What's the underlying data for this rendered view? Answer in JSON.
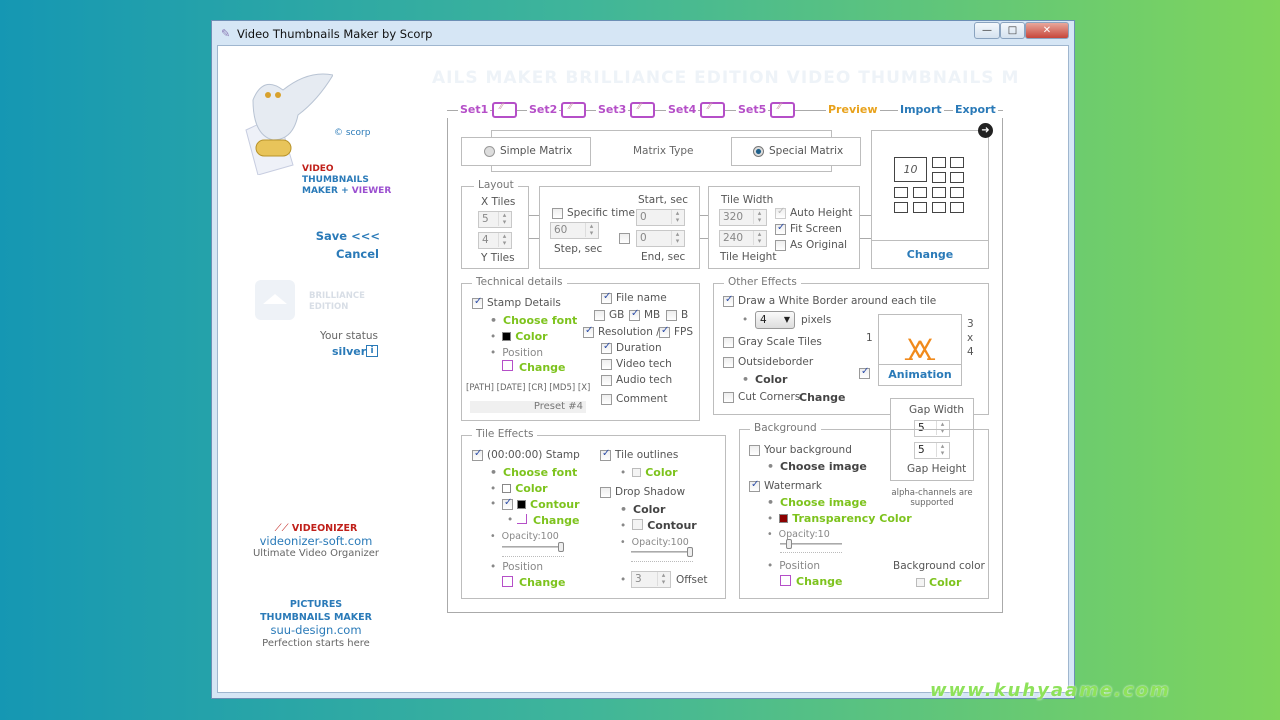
{
  "window": {
    "title": "Video Thumbnails Maker by Scorp",
    "min": "—",
    "max": "□",
    "close": "✕"
  },
  "watermark_text": "AILS MAKER BRILLIANCE EDITION VIDEO THUMBNAILS M",
  "site_watermark": "www.kuhyaame.com",
  "sidebar": {
    "copyright": "© scorp",
    "logo_line1": "VIDEO",
    "logo_line2": "THUMBNAILS",
    "logo_line3a": "MAKER + ",
    "logo_line3b": "VIEWER",
    "save": "Save <<<",
    "cancel": "Cancel",
    "edition": "BRILLIANCE\nEDITION",
    "status_label": "Your status",
    "status_value": "silver",
    "info": "i",
    "promo1": {
      "name": "VIDEONIZER",
      "url": "videonizer-soft.com",
      "tagline": "Ultimate Video Organizer"
    },
    "promo2": {
      "name1": "PICTURES",
      "name2": "THUMBNAILS MAKER",
      "url": "suu-design.com",
      "tagline": "Perfection starts here"
    }
  },
  "nav": {
    "sets": [
      "Set1",
      "Set2",
      "Set3",
      "Set4",
      "Set5"
    ],
    "preview": "Preview",
    "import": "Import",
    "export": "Export"
  },
  "matrix": {
    "simple": "Simple Matrix",
    "type_label": "Matrix Type",
    "special": "Special Matrix",
    "selected": "special",
    "preview_number": "10",
    "change": "Change"
  },
  "layout": {
    "legend": "Layout",
    "x_label": "X Tiles",
    "x_value": "5",
    "y_value": "4",
    "y_label": "Y Tiles"
  },
  "timing": {
    "specific_time": "Specific time",
    "specific_checked": false,
    "start_label": "Start, sec",
    "start_value": "0",
    "step_value": "60",
    "step_label": "Step, sec",
    "end_checked": false,
    "end_value": "0",
    "end_label": "End, sec"
  },
  "tile_size": {
    "width_label": "Tile Width",
    "width": "320",
    "height": "240",
    "height_label": "Tile Height",
    "auto_height": "Auto Height",
    "auto_height_checked": true,
    "fit_screen": "Fit Screen",
    "fit_screen_checked": true,
    "as_original": "As Original",
    "as_original_checked": false
  },
  "technical": {
    "legend": "Technical  details",
    "stamp_details": "Stamp Details",
    "stamp_checked": true,
    "choose_font": "Choose font",
    "color": "Color",
    "position": "Position",
    "change": "Change",
    "tokens": "[PATH] [DATE] [CR] [MD5]  [X]",
    "preset": "Preset #4",
    "file_name": "File name",
    "file_name_checked": true,
    "gb": "GB",
    "gb_checked": false,
    "mb": "MB",
    "mb_checked": true,
    "b": "B",
    "b_checked": false,
    "resolution": "Resolution /",
    "resolution_checked": true,
    "fps": "FPS",
    "fps_checked": true,
    "duration": "Duration",
    "duration_checked": true,
    "video_tech": "Video tech",
    "video_tech_checked": false,
    "audio_tech": "Audio tech",
    "audio_tech_checked": false,
    "comment": "Comment",
    "comment_checked": false
  },
  "other": {
    "legend": "Other Effects",
    "white_border": "Draw a White Border around each tile",
    "white_border_checked": true,
    "border_px": "4",
    "pixels": "pixels",
    "gray": "Gray Scale Tiles",
    "gray_checked": false,
    "outside": "Outsideborder",
    "outside_checked": false,
    "color": "Color",
    "cut": "Cut Corners",
    "cut_checked": false,
    "change": "Change",
    "anim_checked": true,
    "animation": "Animation",
    "n1": "1",
    "n3": "3",
    "x": "x",
    "n4": "4"
  },
  "gap": {
    "width_label": "Gap Width",
    "width": "5",
    "height": "5",
    "height_label": "Gap Height"
  },
  "tile_effects": {
    "legend": "Tile Effects",
    "stamp": "(00:00:00) Stamp",
    "stamp_checked": true,
    "choose_font": "Choose font",
    "color": "Color",
    "contour": "Contour",
    "contour_checked": true,
    "change": "Change",
    "opacity": "Opacity:100",
    "opacity_value": 100,
    "position": "Position",
    "position_change": "Change",
    "outlines": "Tile outlines",
    "outlines_checked": true,
    "outline_color": "Color",
    "drop_shadow": "Drop Shadow",
    "drop_shadow_checked": false,
    "shadow_color": "Color",
    "shadow_contour": "Contour",
    "shadow_opacity": "Opacity:100",
    "shadow_opacity_value": 100,
    "offset_value": "3",
    "offset": "Offset"
  },
  "background": {
    "legend": "Background",
    "your_bg": "Your background",
    "your_bg_checked": false,
    "choose_image": "Choose image",
    "watermark": "Watermark",
    "watermark_checked": true,
    "wm_choose": "Choose image",
    "transparency": "Transparency Color",
    "transparency_color": "#8b0000",
    "opacity": "Opacity:10",
    "opacity_value": 10,
    "position": "Position",
    "change": "Change",
    "alpha": "alpha-channels are\nsupported",
    "bg_color_label": "Background color",
    "bg_color": "Color"
  }
}
